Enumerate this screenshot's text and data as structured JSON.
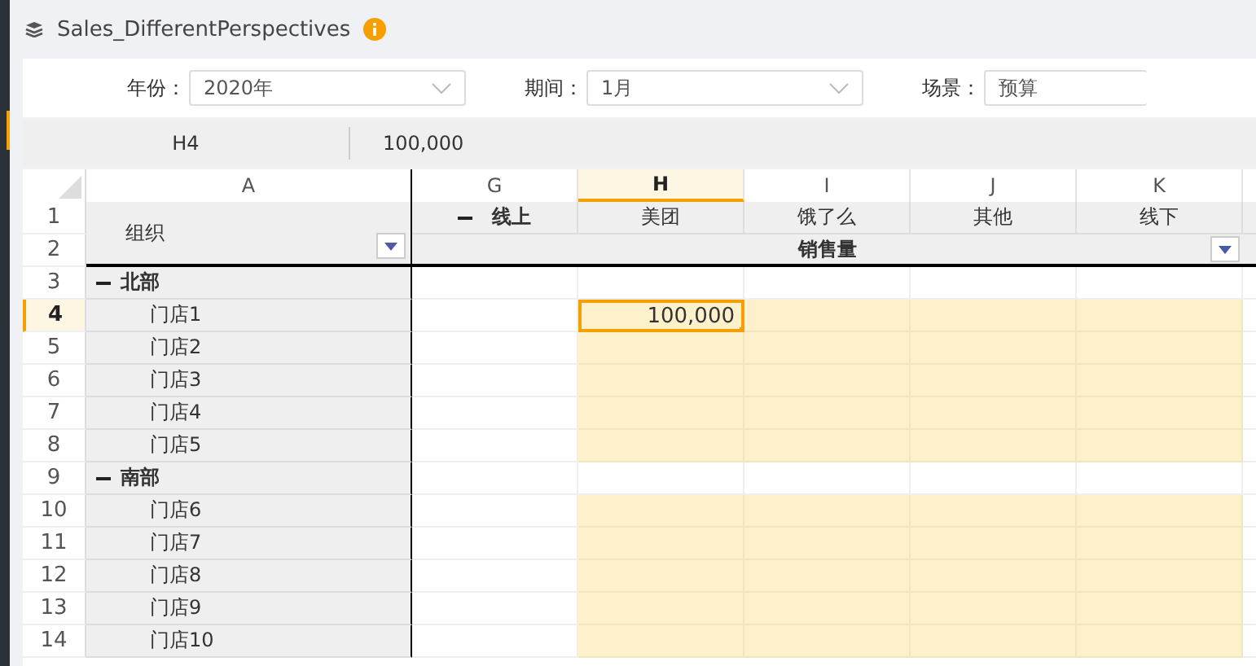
{
  "title": "Sales_DifferentPerspectives",
  "filters": [
    {
      "label": "年份：",
      "value": "2020年",
      "chevron": true
    },
    {
      "label": "期间：",
      "value": "1月",
      "chevron": true
    },
    {
      "label": "场景：",
      "value": "预算",
      "chevron": false
    }
  ],
  "formula_bar": {
    "cell_ref": "H4",
    "value": "100,000"
  },
  "columns": [
    {
      "letter": "A",
      "selected": false
    },
    {
      "letter": "G",
      "selected": false
    },
    {
      "letter": "H",
      "selected": true
    },
    {
      "letter": "I",
      "selected": false
    },
    {
      "letter": "J",
      "selected": false
    },
    {
      "letter": "K",
      "selected": false
    }
  ],
  "header": {
    "row_numbers": [
      "1",
      "2"
    ],
    "dimension_label": "组织",
    "group": {
      "label": "线上",
      "expanded": true
    },
    "members": [
      "美团",
      "饿了么",
      "其他",
      "线下"
    ],
    "measure": "销售量"
  },
  "rows": [
    {
      "number": "3",
      "label": "北部",
      "kind": "group",
      "expanded": true,
      "selected": false,
      "cells": [
        {
          "kind": "plain",
          "selected": false
        },
        {
          "kind": "plain",
          "selected": false
        },
        {
          "kind": "plain",
          "selected": false
        },
        {
          "kind": "plain",
          "selected": false
        },
        {
          "kind": "plain",
          "selected": false
        }
      ]
    },
    {
      "number": "4",
      "label": "门店1",
      "kind": "member",
      "selected": true,
      "cells": [
        {
          "kind": "plain",
          "selected": false
        },
        {
          "kind": "input",
          "selected": true,
          "value": "100,000"
        },
        {
          "kind": "input",
          "selected": false
        },
        {
          "kind": "input",
          "selected": false
        },
        {
          "kind": "input",
          "selected": false
        }
      ]
    },
    {
      "number": "5",
      "label": "门店2",
      "kind": "member",
      "selected": false,
      "cells": [
        {
          "kind": "plain",
          "selected": false
        },
        {
          "kind": "input",
          "selected": false
        },
        {
          "kind": "input",
          "selected": false
        },
        {
          "kind": "input",
          "selected": false
        },
        {
          "kind": "input",
          "selected": false
        }
      ]
    },
    {
      "number": "6",
      "label": "门店3",
      "kind": "member",
      "selected": false,
      "cells": [
        {
          "kind": "plain",
          "selected": false
        },
        {
          "kind": "input",
          "selected": false
        },
        {
          "kind": "input",
          "selected": false
        },
        {
          "kind": "input",
          "selected": false
        },
        {
          "kind": "input",
          "selected": false
        }
      ]
    },
    {
      "number": "7",
      "label": "门店4",
      "kind": "member",
      "selected": false,
      "cells": [
        {
          "kind": "plain",
          "selected": false
        },
        {
          "kind": "input",
          "selected": false
        },
        {
          "kind": "input",
          "selected": false
        },
        {
          "kind": "input",
          "selected": false
        },
        {
          "kind": "input",
          "selected": false
        }
      ]
    },
    {
      "number": "8",
      "label": "门店5",
      "kind": "member",
      "selected": false,
      "cells": [
        {
          "kind": "plain",
          "selected": false
        },
        {
          "kind": "input",
          "selected": false
        },
        {
          "kind": "input",
          "selected": false
        },
        {
          "kind": "input",
          "selected": false
        },
        {
          "kind": "input",
          "selected": false
        }
      ]
    },
    {
      "number": "9",
      "label": "南部",
      "kind": "group",
      "expanded": true,
      "selected": false,
      "cells": [
        {
          "kind": "plain",
          "selected": false
        },
        {
          "kind": "plain",
          "selected": false
        },
        {
          "kind": "plain",
          "selected": false
        },
        {
          "kind": "plain",
          "selected": false
        },
        {
          "kind": "plain",
          "selected": false
        }
      ]
    },
    {
      "number": "10",
      "label": "门店6",
      "kind": "member",
      "selected": false,
      "cells": [
        {
          "kind": "plain",
          "selected": false
        },
        {
          "kind": "input",
          "selected": false
        },
        {
          "kind": "input",
          "selected": false
        },
        {
          "kind": "input",
          "selected": false
        },
        {
          "kind": "input",
          "selected": false
        }
      ]
    },
    {
      "number": "11",
      "label": "门店7",
      "kind": "member",
      "selected": false,
      "cells": [
        {
          "kind": "plain",
          "selected": false
        },
        {
          "kind": "input",
          "selected": false
        },
        {
          "kind": "input",
          "selected": false
        },
        {
          "kind": "input",
          "selected": false
        },
        {
          "kind": "input",
          "selected": false
        }
      ]
    },
    {
      "number": "12",
      "label": "门店8",
      "kind": "member",
      "selected": false,
      "cells": [
        {
          "kind": "plain",
          "selected": false
        },
        {
          "kind": "input",
          "selected": false
        },
        {
          "kind": "input",
          "selected": false
        },
        {
          "kind": "input",
          "selected": false
        },
        {
          "kind": "input",
          "selected": false
        }
      ]
    },
    {
      "number": "13",
      "label": "门店9",
      "kind": "member",
      "selected": false,
      "cells": [
        {
          "kind": "plain",
          "selected": false
        },
        {
          "kind": "input",
          "selected": false
        },
        {
          "kind": "input",
          "selected": false
        },
        {
          "kind": "input",
          "selected": false
        },
        {
          "kind": "input",
          "selected": false
        }
      ]
    },
    {
      "number": "14",
      "label": "门店10",
      "kind": "member",
      "selected": false,
      "cells": [
        {
          "kind": "plain",
          "selected": false
        },
        {
          "kind": "input",
          "selected": false
        },
        {
          "kind": "input",
          "selected": false
        },
        {
          "kind": "input",
          "selected": false
        },
        {
          "kind": "input",
          "selected": false
        }
      ]
    }
  ]
}
